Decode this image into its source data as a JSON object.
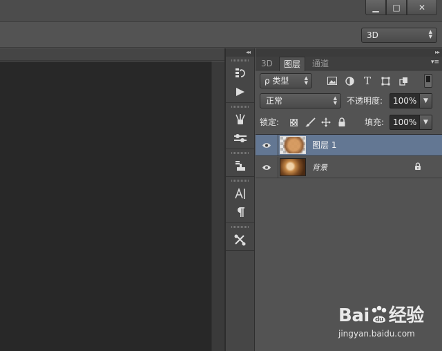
{
  "window": {
    "minimize_glyph": "▁",
    "maximize_glyph": "□",
    "close_glyph": "✕"
  },
  "options_bar": {
    "workspace_value": "3D"
  },
  "icon_column": {
    "collapse_glyph": "◂◂",
    "icons": [
      "history-icon",
      "actions-play-icon",
      "brush-presets-icon",
      "brush-settings-icon",
      "clone-source-icon",
      "character-icon",
      "paragraph-icon",
      "tools-preset-icon"
    ]
  },
  "layers_panel": {
    "collapse_glyph": "▸▸",
    "tabs": [
      "3D",
      "图层",
      "通道"
    ],
    "menu_glyph": "▾≡",
    "filter_kind": "ρ 类型",
    "blend_mode": "正常",
    "opacity_label": "不透明度:",
    "opacity_value": "100%",
    "lock_label": "锁定:",
    "fill_label": "填充:",
    "fill_value": "100%",
    "layers": [
      {
        "name": "图层 1",
        "selected": true,
        "locked": false
      },
      {
        "name": "背景",
        "selected": false,
        "locked": true
      }
    ]
  },
  "watermark": {
    "logo_left": "Bai",
    "logo_right": "经验",
    "url": "jingyan.baidu.com"
  }
}
